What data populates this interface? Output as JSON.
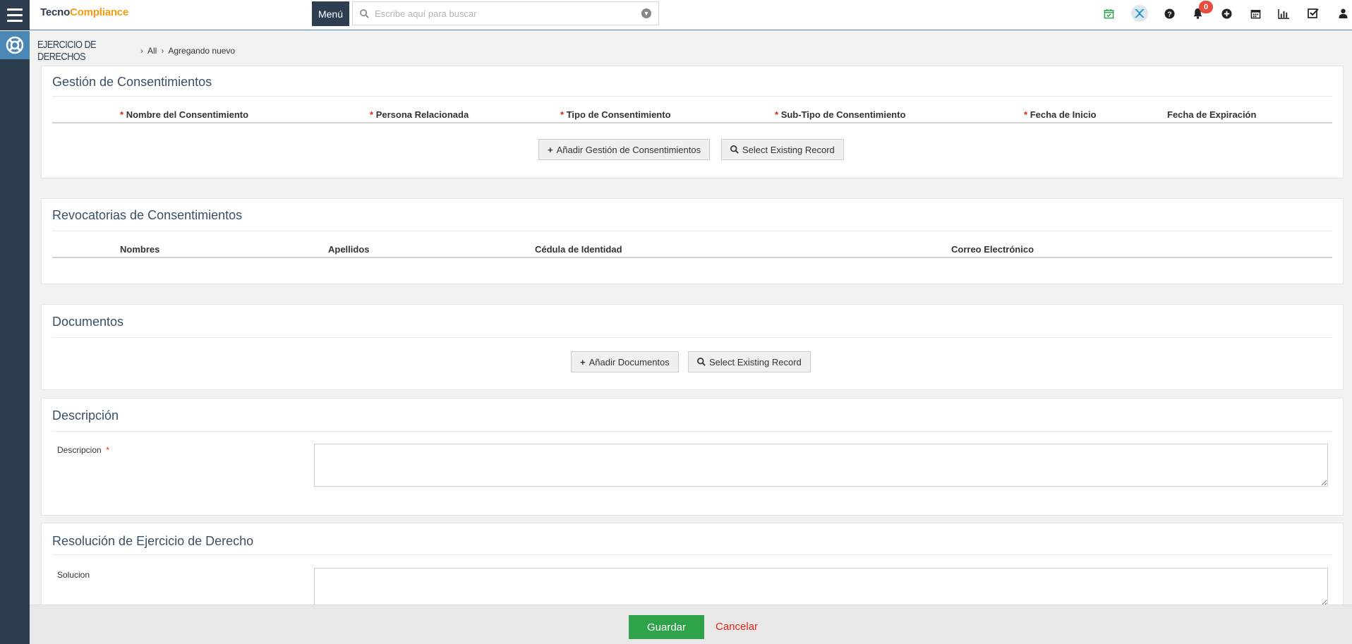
{
  "header": {
    "logo_part1": "Tecno",
    "logo_part2": "Compliance",
    "menu_label": "Menú",
    "search_placeholder": "Escribe aquí para buscar",
    "notification_count": "0",
    "icons": [
      "calendar-check-icon",
      "app-logo-icon",
      "help-icon",
      "bell-icon",
      "plus-circle-icon",
      "calendar-icon",
      "bar-chart-icon",
      "checkbox-icon",
      "user-icon"
    ]
  },
  "breadcrumb": {
    "module": "EJERCICIO DE DERECHOS",
    "level1": "All",
    "level2": "Agregando nuevo"
  },
  "consent_panel": {
    "title": "Gestión de Consentimientos",
    "columns": [
      {
        "label": "Nombre del Consentimiento",
        "required": true
      },
      {
        "label": "Persona Relacionada",
        "required": true
      },
      {
        "label": "Tipo de Consentimiento",
        "required": true
      },
      {
        "label": "Sub-Tipo de Consentimiento",
        "required": true
      },
      {
        "label": "Fecha de Inicio",
        "required": true
      },
      {
        "label": "Fecha de Expiración",
        "required": false
      }
    ],
    "add_button": "Añadir Gestión de Consentimientos",
    "select_button": "Select Existing Record"
  },
  "revocation_panel": {
    "title": "Revocatorias de Consentimientos",
    "columns": [
      "Nombres",
      "Apellidos",
      "Cédula de Identidad",
      "Correo Electrónico"
    ]
  },
  "documents_panel": {
    "title": "Documentos",
    "add_button": "Añadir Documentos",
    "select_button": "Select Existing Record"
  },
  "description_panel": {
    "title": "Descripción",
    "field_label": "Descripcion",
    "required_mark": "*",
    "value": ""
  },
  "resolution_panel": {
    "title": "Resolución de Ejercicio de Derecho",
    "field_label": "Solucion",
    "value": ""
  },
  "footer": {
    "save_label": "Guardar",
    "cancel_label": "Cancelar"
  },
  "colors": {
    "nav_dark": "#2c3e50",
    "accent_blue": "#4a87b5",
    "brand_orange": "#f39c12",
    "required_red": "#e1251b",
    "save_green": "#2ea34a"
  }
}
